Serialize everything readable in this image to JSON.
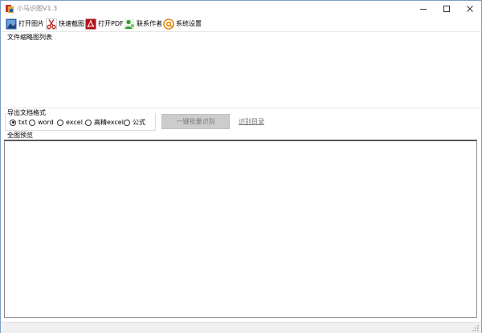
{
  "window": {
    "title": "小马识图V1.3"
  },
  "toolbar": {
    "items": [
      {
        "label": "打开图片",
        "icon": "open-image-icon"
      },
      {
        "label": "快速截图",
        "icon": "screenshot-scissors-icon"
      },
      {
        "label": "打开PDF",
        "icon": "pdf-icon"
      },
      {
        "label": "联系作者",
        "icon": "contact-person-icon"
      },
      {
        "label": "系统设置",
        "icon": "settings-at-icon"
      }
    ]
  },
  "thumbnail_section": {
    "label": "文件缩略图列表"
  },
  "export": {
    "label": "导出文档格式",
    "options": [
      {
        "label": "txt",
        "checked": true
      },
      {
        "label": "word",
        "checked": false
      },
      {
        "label": "excel",
        "checked": false
      },
      {
        "label": "高精excel",
        "checked": false
      },
      {
        "label": "公式",
        "checked": false
      }
    ]
  },
  "actions": {
    "batch_label": "一键批量识别",
    "directory_link": "识别目录"
  },
  "preview": {
    "label": "全图预览"
  },
  "colors": {
    "window_border": "#7a9cc4",
    "button_disabled_bg": "#cccccc",
    "link": "#6f6f6f"
  }
}
